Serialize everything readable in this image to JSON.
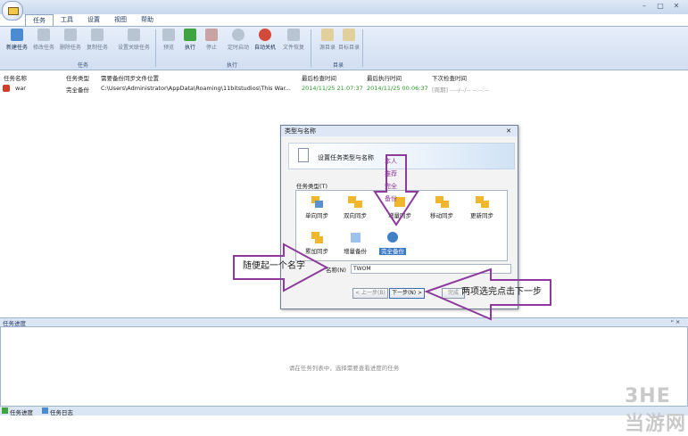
{
  "tabs": [
    "任务",
    "工具",
    "设置",
    "视图",
    "帮助"
  ],
  "window_controls": [
    "–",
    "□",
    "✕"
  ],
  "ribbon": {
    "task_buttons": [
      "新建任务",
      "修改任务",
      "删除任务",
      "复制任务",
      "设置关联任务"
    ],
    "task_group": "任务",
    "exec_buttons": [
      "预览",
      "执行",
      "停止",
      "定时启动",
      "自动关机",
      "文件恢复"
    ],
    "exec_group": "执行",
    "dir_buttons": [
      "源目录",
      "目标目录"
    ],
    "dir_group": "目录"
  },
  "table": {
    "headers": [
      "任务名称",
      "任务类型",
      "需要备份同步文件位置",
      "最后检查时间",
      "最后执行时间",
      "下次检查时间"
    ],
    "rows": [
      {
        "name": "war",
        "type": "完全备份",
        "path": "C:\\Users\\Administrator\\AppData\\Roaming\\11bitstudios\\This War...",
        "last_check": "2014/11/25 21:07:37",
        "last_exec": "2014/11/25 00:06:37",
        "next_check": "[周期] ----/--/-- --:--:--"
      }
    ]
  },
  "dialog": {
    "title": "类型与名称",
    "banner_title": "设置任务类型与名称",
    "type_label": "任务类型(T)",
    "types": [
      "单向同步",
      "双向同步",
      "增量同步",
      "移动同步",
      "更新同步",
      "累加同步",
      "增量备份",
      "完全备份"
    ],
    "name_label": "名称(N)",
    "name_value": "TWOM",
    "buttons": {
      "prev": "< 上一步(B)",
      "next": "下一步(N) >",
      "finish": "完成"
    }
  },
  "annotations": {
    "overlay_words": [
      "本人",
      "推荐",
      "完全",
      "备份"
    ],
    "left_note": "随便起一个名字",
    "right_note": "两项选完点击下一步"
  },
  "progress_panel": {
    "title": "任务进度",
    "pin": "ᵖ ×",
    "empty_text": "请在任务列表中，选择需要查看进度的任务"
  },
  "statusbar": [
    "任务进度",
    "任务日志"
  ],
  "watermark": "3HE当游网",
  "colors": {
    "accent": "#8e3a9c",
    "ribbon": "#d2dff1",
    "green_text": "#2a9a2a"
  }
}
